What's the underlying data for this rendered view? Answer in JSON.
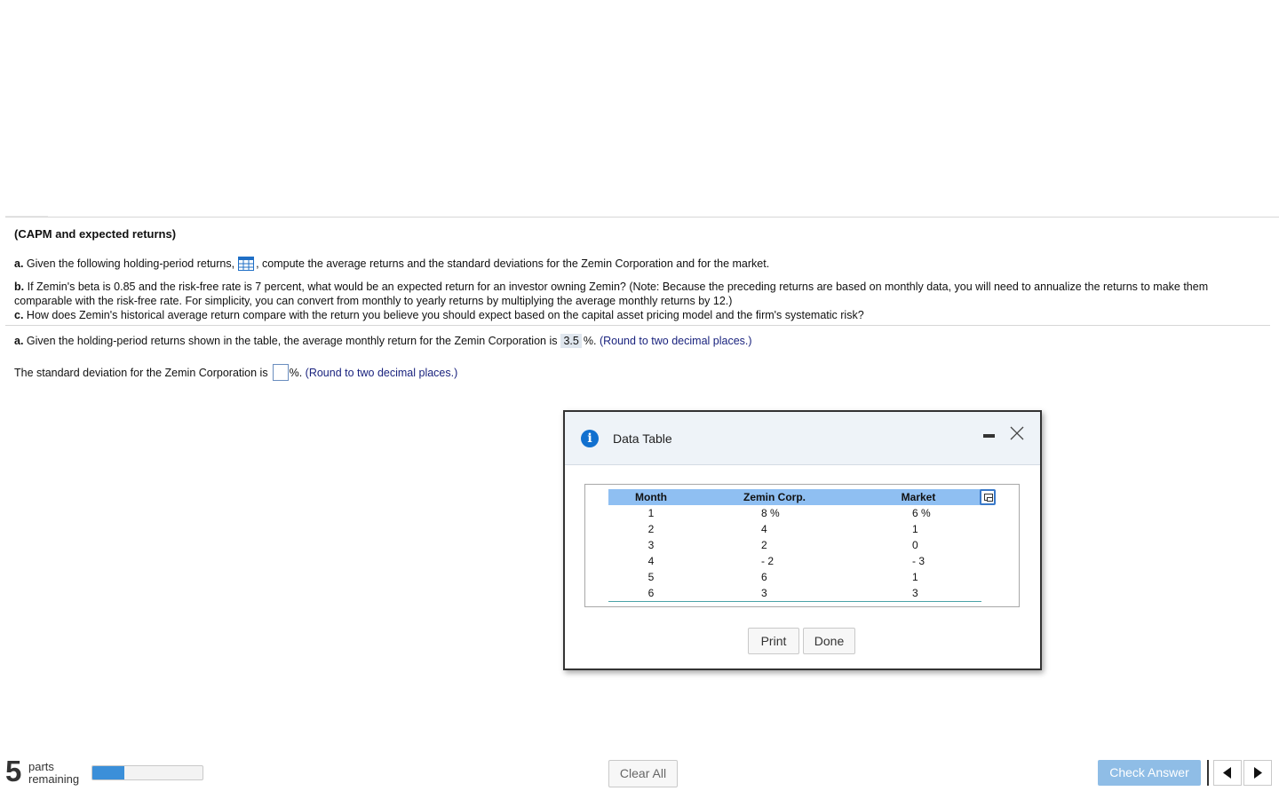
{
  "question": {
    "title": "(CAPM and expected returns)",
    "a_label": "a.",
    "a_text_before": "Given the following holding-period returns,",
    "a_text_after": ", compute the average returns and the standard deviations for the Zemin Corporation and for the market.",
    "b_label": "b.",
    "b_text": "If Zemin's beta is 0.85 and the risk-free rate is 7 percent, what would be an expected return for an investor owning Zemin? (Note: Because the preceding returns are based on monthly data, you will need to annualize the returns to make them comparable with the risk-free rate.  For simplicity, you can convert from monthly to yearly returns by multiplying the average monthly returns by 12.)",
    "c_label": "c.",
    "c_text": "How does Zemin's historical average return compare with the return you believe you should expect based on the capital asset pricing model and the firm's systematic risk?",
    "data_icon": "grid-table-icon"
  },
  "answers": {
    "a_label": "a.",
    "avg_text": "Given the holding-period returns shown in the table, the average monthly return for the Zemin Corporation is",
    "avg_value": "3.5",
    "avg_unit": "%.",
    "avg_hint": "(Round to two decimal places.)",
    "sd_text": "The standard deviation for the Zemin Corporation is",
    "sd_value": "",
    "sd_unit": "%.",
    "sd_hint": "(Round to two decimal places.)"
  },
  "dialog": {
    "title": "Data Table",
    "columns": [
      "Month",
      "Zemin Corp.",
      "Market"
    ],
    "rows": [
      [
        "1",
        "8 %",
        "6 %"
      ],
      [
        "2",
        "4",
        "1"
      ],
      [
        "3",
        "2",
        "0"
      ],
      [
        "4",
        "- 2",
        "- 3"
      ],
      [
        "5",
        "6",
        "1"
      ],
      [
        "6",
        "3",
        "3"
      ]
    ],
    "print_label": "Print",
    "done_label": "Done"
  },
  "footer": {
    "parts_count": "5",
    "parts_label_1": "parts",
    "parts_label_2": "remaining",
    "progress_fraction": 0.29,
    "clear_label": "Clear All",
    "check_label": "Check Answer"
  },
  "colors": {
    "accent": "#1170cf",
    "header_row": "#8fbff2",
    "check_button": "#8fbde6",
    "progress": "#3b8fd9",
    "hint": "#1a237e"
  }
}
